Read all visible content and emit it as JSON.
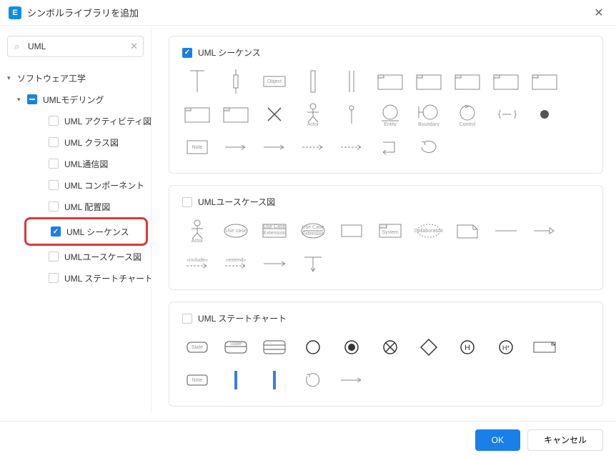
{
  "title": "シンボルライブラリを追加",
  "search": {
    "value": "UML",
    "placeholder": ""
  },
  "tree": {
    "root": "ソフトウェア工学",
    "node": "UMLモデリング",
    "items": [
      {
        "label": "UML アクティビティ図",
        "checked": false
      },
      {
        "label": "UML クラス図",
        "checked": false
      },
      {
        "label": "UML通信図",
        "checked": false
      },
      {
        "label": "UML コンポーネント",
        "checked": false
      },
      {
        "label": "UML 配置図",
        "checked": false
      },
      {
        "label": "UML シーケンス",
        "checked": true,
        "highlight": true
      },
      {
        "label": "UMLユースケース図",
        "checked": false
      },
      {
        "label": "UML ステートチャート",
        "checked": false
      }
    ]
  },
  "groups": [
    {
      "title": "UML シーケンス",
      "checked": true
    },
    {
      "title": "UMLユースケース図",
      "checked": false
    },
    {
      "title": "UML ステートチャート",
      "checked": false
    }
  ],
  "buttons": {
    "ok": "OK",
    "cancel": "キャンセル"
  }
}
